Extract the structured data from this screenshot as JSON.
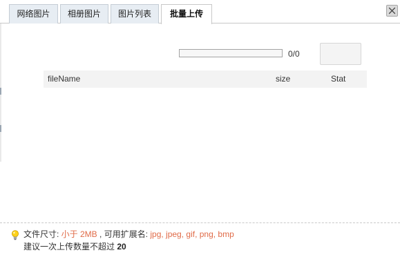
{
  "tabs": [
    {
      "label": "网络图片",
      "active": false
    },
    {
      "label": "相册图片",
      "active": false
    },
    {
      "label": "图片列表",
      "active": false
    },
    {
      "label": "批量上传",
      "active": true
    }
  ],
  "close_icon": "close-icon",
  "upload": {
    "progress_fraction": 0,
    "progress_text": "0/0",
    "button_label": ""
  },
  "table": {
    "headers": {
      "file_name": "fileName",
      "size": "size",
      "status": "Stat"
    },
    "rows": []
  },
  "footer": {
    "tip_icon": "lightbulb-icon",
    "line1": {
      "prefix": "文件尺寸: ",
      "size_limit": "小于 2MB",
      "mid": " , 可用扩展名: ",
      "extensions": "jpg, jpeg, gif, png, bmp"
    },
    "line2": {
      "prefix": "建议一次上传数量不超过 ",
      "max_count": "20"
    }
  },
  "colors": {
    "highlight": "#e06b48",
    "progress_fill": "#7fb2e5",
    "tab_inactive_bg": "#e7edf3",
    "header_bg": "#f3f3f3"
  }
}
